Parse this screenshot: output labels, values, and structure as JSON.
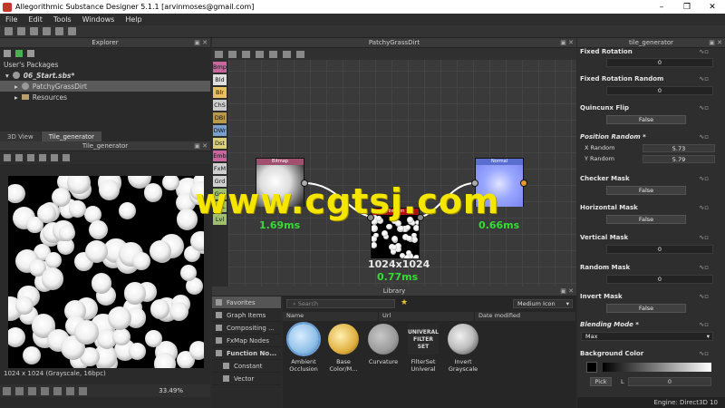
{
  "window": {
    "title": "Allegorithmic Substance Designer 5.1.1 [arvinmoses@gmail.com]",
    "minimize": "–",
    "maximize": "❐",
    "close": "✕"
  },
  "menu": [
    "File",
    "Edit",
    "Tools",
    "Windows",
    "Help"
  ],
  "explorer": {
    "title": "Explorer",
    "section": "User's Packages",
    "package": "06_Start.sbs*",
    "graph": "PatchyGrassDirt",
    "resources": "Resources"
  },
  "view_tabs": [
    "3D View",
    "Tile_generator"
  ],
  "view2d": {
    "title": "Tile_generator",
    "info": "1024 x 1024 (Grayscale, 16bpc)",
    "zoom": "33.49%"
  },
  "graph": {
    "title": "PatchyGrassDirt",
    "palette": [
      "Bmp",
      "Bld",
      "Blr",
      "ChS",
      "DBI",
      "DWr",
      "Dst",
      "Emb",
      "FxM",
      "Grd",
      "Gry",
      "HSL",
      "Lvl"
    ],
    "palette_colors": [
      "#c9669e",
      "#e0e0e0",
      "#e8c060",
      "#cfcfcf",
      "#b89a4a",
      "#7aa0d0",
      "#d8d07a",
      "#c9669e",
      "#cfcfcf",
      "#d0d0d0",
      "#9fbf6f",
      "#9fbf6f",
      "#9fbf6f"
    ],
    "nodes": {
      "bitmap": {
        "header": "Bitmap",
        "timing": "1.69ms"
      },
      "tile": {
        "header": "Tile Gen",
        "size": "1024x1024",
        "timing": "0.77ms"
      },
      "normal": {
        "header": "Normal",
        "timing": "0.66ms"
      }
    },
    "watermark": "www.cgtsj.com"
  },
  "library": {
    "title": "Library",
    "search_placeholder": "Search",
    "icon_size": "Medium Icon",
    "columns": [
      "Name",
      "Url",
      "Date modified"
    ],
    "categories": [
      "Favorites",
      "Graph Items",
      "Compositing ...",
      "FxMap Nodes",
      "Function No...",
      "Constant",
      "Vector"
    ],
    "items": [
      {
        "label": "Ambient Occlusion",
        "color": "#8fc0e8"
      },
      {
        "label": "Base Color/M...",
        "color": "#e0b040"
      },
      {
        "label": "Curvature",
        "color": "#9a9a9a"
      },
      {
        "label": "FilterSet Univeral",
        "color": "#333333",
        "badge": "UNIVERAL FILTER SET"
      },
      {
        "label": "Invert Grayscale",
        "color": "#bdbdbd"
      }
    ]
  },
  "properties": {
    "title": "tile_generator",
    "fixed_rotation": {
      "label": "Fixed Rotation",
      "value": "0"
    },
    "fixed_rotation_random": {
      "label": "Fixed Rotation Random",
      "value": "0"
    },
    "quincunx_flip": {
      "label": "Quincunx Flip",
      "value": "False"
    },
    "position_random": {
      "label": "Position Random *",
      "x_label": "X Random",
      "x_value": "5.73",
      "y_label": "Y Random",
      "y_value": "5.79"
    },
    "checker_mask": {
      "label": "Checker Mask",
      "value": "False"
    },
    "horizontal_mask": {
      "label": "Horizontal Mask",
      "value": "False"
    },
    "vertical_mask": {
      "label": "Vertical Mask",
      "value": "0"
    },
    "random_mask": {
      "label": "Random Mask",
      "value": "0"
    },
    "invert_mask": {
      "label": "Invert Mask",
      "value": "False"
    },
    "blending_mode": {
      "label": "Blending Mode *",
      "value": "Max"
    },
    "background_color": {
      "label": "Background Color",
      "pick": "Pick",
      "l_label": "L",
      "l_value": "0"
    }
  },
  "status": {
    "engine": "Engine: Direct3D 10"
  }
}
